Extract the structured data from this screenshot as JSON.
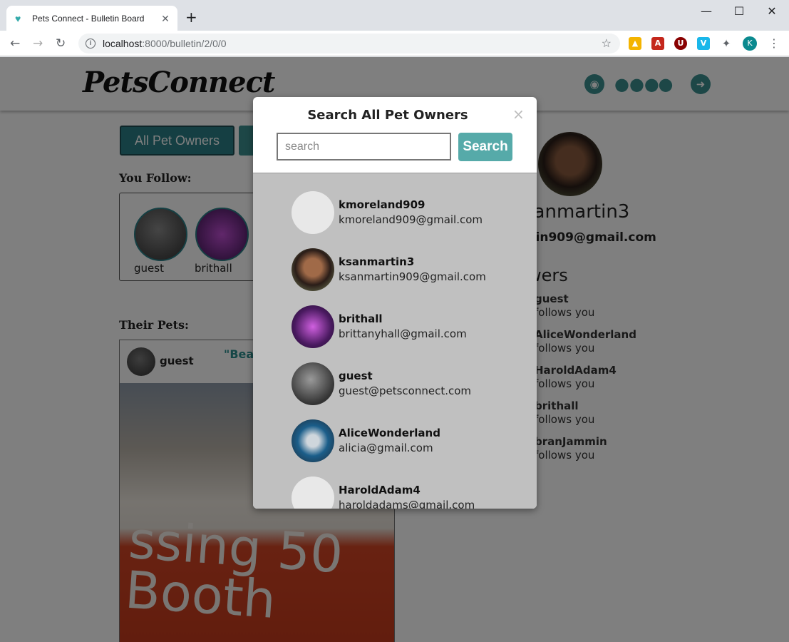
{
  "browser": {
    "tab_title": "Pets Connect - Bulletin Board",
    "url_host": "localhost",
    "url_path": ":8000/bulletin/2/0/0",
    "profile_initial": "K"
  },
  "header": {
    "logo": "PetsConnect"
  },
  "main": {
    "all_owners_button": "All Pet Owners",
    "you_follow_title": "You Follow:",
    "followed": [
      {
        "name": "guest"
      },
      {
        "name": "brithall"
      }
    ],
    "their_pets_title": "Their Pets:",
    "pet_card": {
      "owner": "guest",
      "quote": "\"Bea",
      "sign_text": "ssing 50\nBooth"
    }
  },
  "profile": {
    "name": "sanmartin3",
    "email": "rtin909@gmail.com",
    "followers_title": "wers",
    "followers": [
      {
        "name": "guest",
        "status": "follows you"
      },
      {
        "name": "AliceWonderland",
        "status": "follows you"
      },
      {
        "name": "HaroldAdam4",
        "status": "follows you"
      },
      {
        "name": "brithall",
        "status": "follows you"
      },
      {
        "name": "branJammin",
        "status": "follows you"
      }
    ]
  },
  "modal": {
    "title": "Search All Pet Owners",
    "close": "×",
    "search_placeholder": "search",
    "search_value": "",
    "search_button": "Search",
    "results": [
      {
        "username": "kmoreland909",
        "email": "kmoreland909@gmail.com",
        "avatar": "none"
      },
      {
        "username": "ksanmartin3",
        "email": "ksanmartin909@gmail.com",
        "avatar": "woman-portrait"
      },
      {
        "username": "brithall",
        "email": "brittanyhall@gmail.com",
        "avatar": "purple-leaves"
      },
      {
        "username": "guest",
        "email": "guest@petsconnect.com",
        "avatar": "cat"
      },
      {
        "username": "AliceWonderland",
        "email": "alicia@gmail.com",
        "avatar": "phone-hand"
      },
      {
        "username": "HaroldAdam4",
        "email": "haroldadams@gmail.com",
        "avatar": "none"
      }
    ]
  },
  "colors": {
    "accent": "#56aaa9",
    "dark_accent": "#2a7f86"
  }
}
